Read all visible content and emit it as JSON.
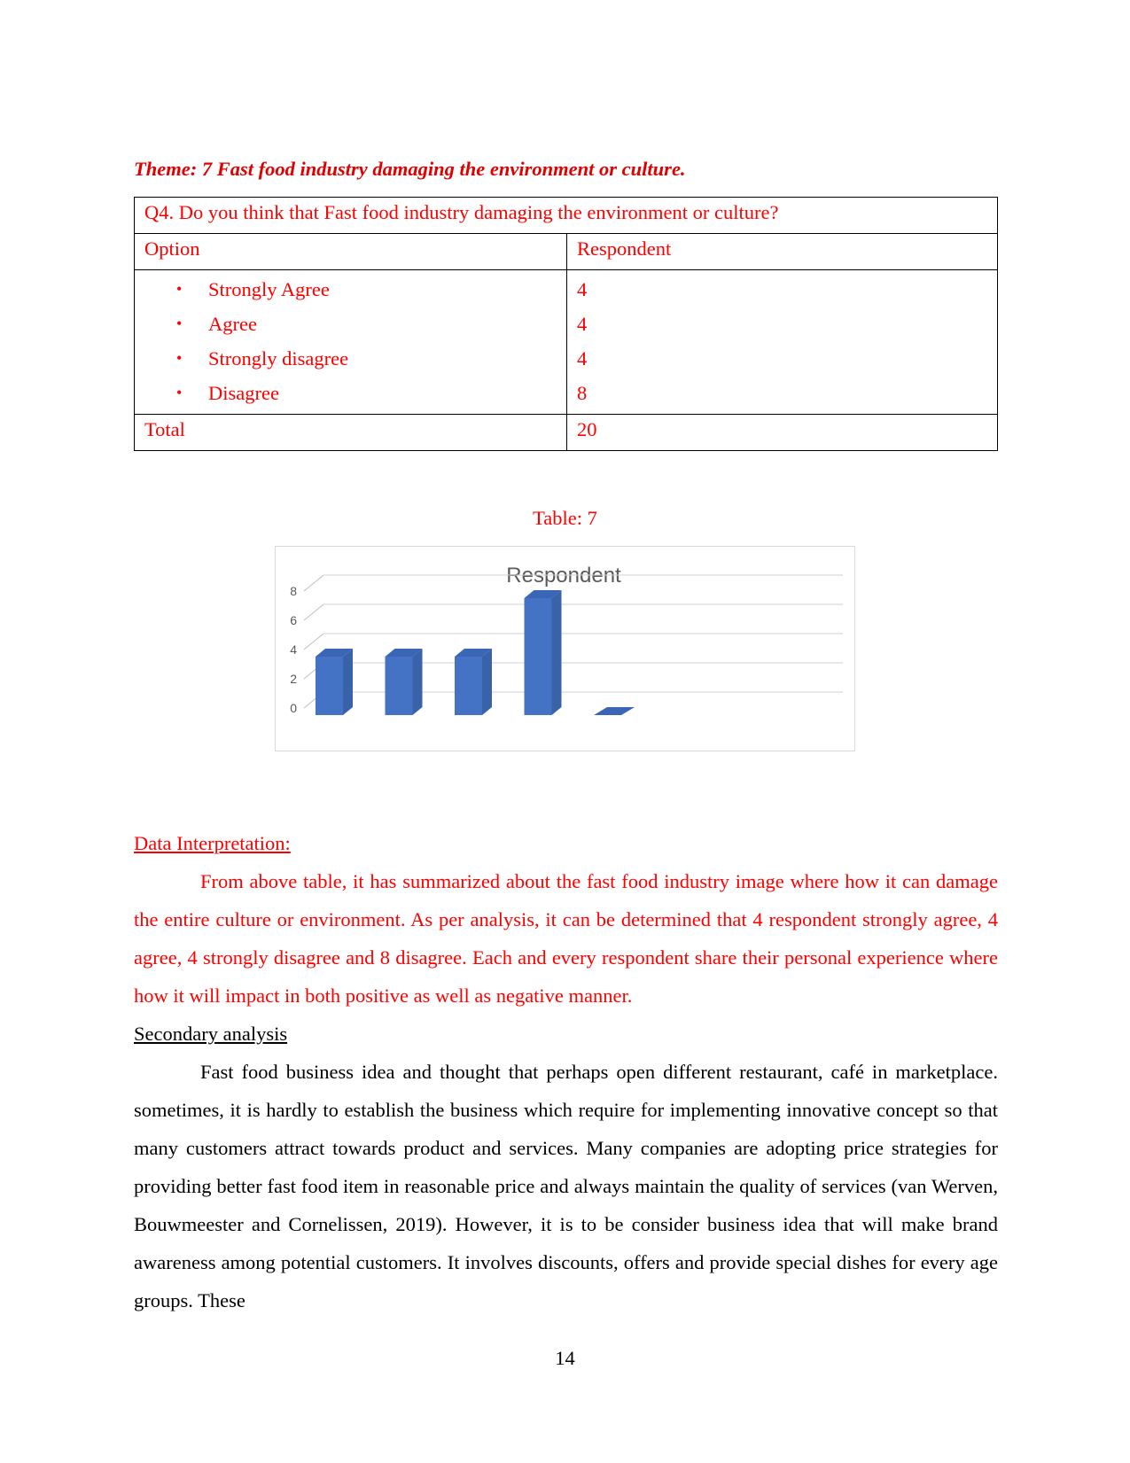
{
  "theme_heading": "Theme: 7 Fast food industry damaging the environment or culture.",
  "table": {
    "question": "Q4. Do you think that Fast food industry damaging the environment or culture?",
    "headers": [
      "Option",
      "Respondent"
    ],
    "rows": [
      {
        "option": "Strongly Agree",
        "respondent": "4"
      },
      {
        "option": "Agree",
        "respondent": "4"
      },
      {
        "option": "Strongly disagree",
        "respondent": "4"
      },
      {
        "option": "Disagree",
        "respondent": "8"
      }
    ],
    "total_label": "Total",
    "total_value": "20",
    "bullet": "•"
  },
  "caption": "Table: 7",
  "chart_data": {
    "type": "bar",
    "title": "Respondent",
    "categories": [
      "Strongly Agree",
      "Agree",
      "Strongly disagree",
      "Disagree",
      ""
    ],
    "values": [
      4,
      4,
      4,
      8,
      0
    ],
    "ylim": [
      0,
      8
    ],
    "yticks": [
      "0",
      "2",
      "4",
      "6",
      "8"
    ],
    "grid": true,
    "style": "3d-column",
    "bar_color": "#4472c4"
  },
  "interpretation": {
    "heading": "Data Interpretation: ",
    "text": "From above table, it has summarized about the fast food industry image where how it can damage the entire culture or environment. As per analysis, it can be determined that 4 respondent strongly agree, 4 agree, 4 strongly disagree and 8 disagree. Each and every respondent share their personal experience where how it will impact in both positive as well as negative manner."
  },
  "secondary": {
    "heading": "Secondary analysis",
    "text": "Fast food business idea and thought that perhaps open different restaurant, café in marketplace. sometimes, it is hardly to establish the business which require for implementing innovative concept so that many customers attract towards product and services. Many companies are adopting price strategies for providing better fast food item in reasonable price and always maintain the quality of services (van Werven, Bouwmeester and Cornelissen, 2019). However, it is to be consider business idea that will make brand awareness among potential customers. It involves discounts, offers and provide special dishes for every age groups. These"
  },
  "page_number": "14"
}
